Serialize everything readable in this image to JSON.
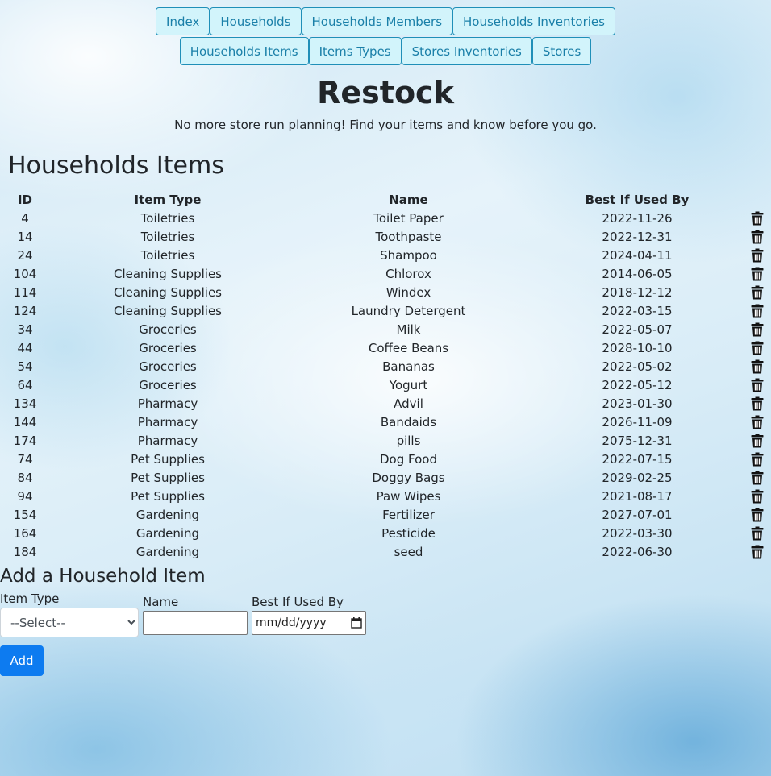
{
  "nav": {
    "row1": [
      "Index",
      "Households",
      "Households Members",
      "Households Inventories"
    ],
    "row2": [
      "Households Items",
      "Items Types",
      "Stores Inventories",
      "Stores"
    ]
  },
  "site": {
    "title": "Restock",
    "tagline": "No more store run planning! Find your items and know before you go."
  },
  "section_title": "Households Items",
  "table": {
    "columns": [
      "ID",
      "Item Type",
      "Name",
      "Best If Used By"
    ],
    "rows": [
      [
        "4",
        "Toiletries",
        "Toilet Paper",
        "2022-11-26"
      ],
      [
        "14",
        "Toiletries",
        "Toothpaste",
        "2022-12-31"
      ],
      [
        "24",
        "Toiletries",
        "Shampoo",
        "2024-04-11"
      ],
      [
        "104",
        "Cleaning Supplies",
        "Chlorox",
        "2014-06-05"
      ],
      [
        "114",
        "Cleaning Supplies",
        "Windex",
        "2018-12-12"
      ],
      [
        "124",
        "Cleaning Supplies",
        "Laundry Detergent",
        "2022-03-15"
      ],
      [
        "34",
        "Groceries",
        "Milk",
        "2022-05-07"
      ],
      [
        "44",
        "Groceries",
        "Coffee Beans",
        "2028-10-10"
      ],
      [
        "54",
        "Groceries",
        "Bananas",
        "2022-05-02"
      ],
      [
        "64",
        "Groceries",
        "Yogurt",
        "2022-05-12"
      ],
      [
        "134",
        "Pharmacy",
        "Advil",
        "2023-01-30"
      ],
      [
        "144",
        "Pharmacy",
        "Bandaids",
        "2026-11-09"
      ],
      [
        "174",
        "Pharmacy",
        "pills",
        "2075-12-31"
      ],
      [
        "74",
        "Pet Supplies",
        "Dog Food",
        "2022-07-15"
      ],
      [
        "84",
        "Pet Supplies",
        "Doggy Bags",
        "2029-02-25"
      ],
      [
        "94",
        "Pet Supplies",
        "Paw Wipes",
        "2021-08-17"
      ],
      [
        "154",
        "Gardening",
        "Fertilizer",
        "2027-07-01"
      ],
      [
        "164",
        "Gardening",
        "Pesticide",
        "2022-03-30"
      ],
      [
        "184",
        "Gardening",
        "seed",
        "2022-06-30"
      ]
    ],
    "row_action_icon": "trash-icon"
  },
  "add_form": {
    "title": "Add a Household Item",
    "item_type_label": "Item Type",
    "item_type_selected": "--Select--",
    "name_label": "Name",
    "name_value": "",
    "date_label": "Best If Used By",
    "date_placeholder": "mm/dd/yyyy",
    "submit_label": "Add"
  },
  "colors": {
    "nav_bg": "#d2f4fb",
    "nav_border": "#1f8fb8",
    "nav_text": "#1a7fa8",
    "primary_button": "#0d7bf0"
  }
}
